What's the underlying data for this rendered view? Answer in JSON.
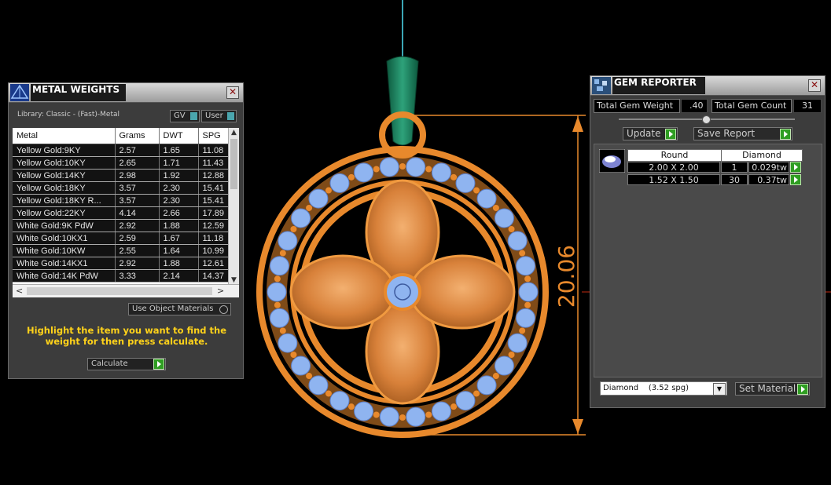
{
  "metal_weights": {
    "title": "METAL WEIGHTS",
    "close": "✕",
    "library": "Library: Classic - (Fast)-Metal",
    "toggles": [
      "GV",
      "User"
    ],
    "columns": [
      "Metal",
      "Grams",
      "DWT",
      "SPG"
    ],
    "rows": [
      [
        "Yellow Gold:9KY",
        "2.57",
        "1.65",
        "11.08"
      ],
      [
        "Yellow Gold:10KY",
        "2.65",
        "1.71",
        "11.43"
      ],
      [
        "Yellow Gold:14KY",
        "2.98",
        "1.92",
        "12.88"
      ],
      [
        "Yellow Gold:18KY",
        "3.57",
        "2.30",
        "15.41"
      ],
      [
        "Yellow Gold:18KY R...",
        "3.57",
        "2.30",
        "15.41"
      ],
      [
        "Yellow Gold:22KY",
        "4.14",
        "2.66",
        "17.89"
      ],
      [
        "White Gold:9K PdW",
        "2.92",
        "1.88",
        "12.59"
      ],
      [
        "White Gold:10KX1",
        "2.59",
        "1.67",
        "11.18"
      ],
      [
        "White Gold:10KW",
        "2.55",
        "1.64",
        "10.99"
      ],
      [
        "White Gold:14KX1",
        "2.92",
        "1.88",
        "12.61"
      ],
      [
        "White Gold:14K PdW",
        "3.33",
        "2.14",
        "14.37"
      ]
    ],
    "use_object_materials": "Use Object Materials",
    "instruction": "Highlight the item you want to find the weight for then press calculate.",
    "calculate": "Calculate"
  },
  "gem_reporter": {
    "title": "GEM REPORTER",
    "close": "✕",
    "total_weight_label": "Total Gem Weight",
    "total_weight_value": ".40",
    "total_count_label": "Total Gem Count",
    "total_count_value": "31",
    "update": "Update",
    "save_report": "Save Report",
    "shape": "Round",
    "material": "Diamond",
    "gems": [
      {
        "size": "2.00 X 2.00",
        "count": "1",
        "weight": "0.029tw"
      },
      {
        "size": "1.52 X 1.50",
        "count": "30",
        "weight": "0.37tw"
      }
    ],
    "material_select": "Diamond    (3.52 spg)",
    "set_material": "Set Material"
  },
  "viewport": {
    "dimension_label": "20.06",
    "colors": {
      "metal": "#e8892c",
      "gem": "#8fb4f0",
      "bail": "#1c7a5a",
      "dim": "#e8892c"
    }
  }
}
